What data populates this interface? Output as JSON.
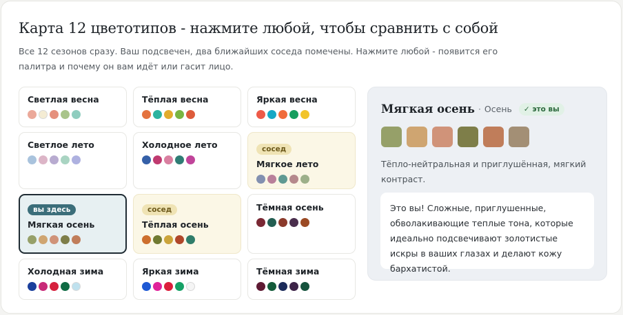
{
  "header": {
    "title": "Карта 12 цветотипов - нажмите любой, чтобы сравнить с собой",
    "subtitle": "Все 12 сезонов сразу. Ваш подсвечен, два ближайших соседа помечены. Нажмите любой - появится его палитра и почему он вам идёт или гасит лицо."
  },
  "tags": {
    "neighbor": "сосед",
    "current": "вы здесь"
  },
  "types": [
    {
      "name": "Светлая весна",
      "state": "normal",
      "colors": [
        "#eba99a",
        "#f4ecd4",
        "#e5907d",
        "#a9c48a",
        "#8fcdbf"
      ]
    },
    {
      "name": "Тёплая весна",
      "state": "normal",
      "colors": [
        "#e4733f",
        "#2db39f",
        "#e2ac2d",
        "#79b542",
        "#dd5b3b"
      ]
    },
    {
      "name": "Яркая весна",
      "state": "normal",
      "colors": [
        "#ee5a48",
        "#16a8c5",
        "#f06c3b",
        "#159e5f",
        "#f2c42a"
      ]
    },
    {
      "name": "Светлое лето",
      "state": "normal",
      "colors": [
        "#a9c3dd",
        "#dcb5c7",
        "#b8abd0",
        "#a9d4c2",
        "#aeb1e0"
      ]
    },
    {
      "name": "Холодное лето",
      "state": "normal",
      "colors": [
        "#3560a8",
        "#c03a70",
        "#d97fa0",
        "#2f7d75",
        "#c0449a"
      ]
    },
    {
      "name": "Мягкое лето",
      "state": "neighbor",
      "colors": [
        "#8290b0",
        "#b8809a",
        "#5f9a92",
        "#b5898c",
        "#9db08a"
      ]
    },
    {
      "name": "Мягкая осень",
      "state": "current",
      "colors": [
        "#96a069",
        "#cfa571",
        "#d09379",
        "#7e7e49",
        "#c07d5a"
      ]
    },
    {
      "name": "Тёплая осень",
      "state": "neighbor",
      "colors": [
        "#cd6f2d",
        "#707a31",
        "#cba43b",
        "#b0472a",
        "#2f7d6a"
      ]
    },
    {
      "name": "Тёмная осень",
      "state": "normal",
      "colors": [
        "#7a2834",
        "#235e52",
        "#8b3a2b",
        "#4a2e4d",
        "#9b4a24"
      ]
    },
    {
      "name": "Холодная зима",
      "state": "normal",
      "colors": [
        "#1a3f9c",
        "#c82a78",
        "#d6213d",
        "#0f6b44",
        "#bfe1ee"
      ]
    },
    {
      "name": "Яркая зима",
      "state": "normal",
      "colors": [
        "#1e59d4",
        "#e0229a",
        "#dc1e3c",
        "#16a166",
        "#f5f5f5"
      ]
    },
    {
      "name": "Тёмная зима",
      "state": "normal",
      "colors": [
        "#5e1a33",
        "#135b3a",
        "#1c2b5a",
        "#3d2448",
        "#16533d"
      ]
    }
  ],
  "detail": {
    "title": "Мягкая осень",
    "separator": "·",
    "season": "Осень",
    "badge": "✓ это вы",
    "swatches": [
      "#96a069",
      "#cfa571",
      "#d09379",
      "#7e7e49",
      "#c07d5a",
      "#a38f75"
    ],
    "description": "Тёпло-нейтральная и приглушённая, мягкий контраст.",
    "note": "Это вы! Сложные, приглушенные, обволакивающие теплые тона, которые идеально подсвечивают золотистые искры в ваших глазах и делают кожу бархатистой."
  }
}
